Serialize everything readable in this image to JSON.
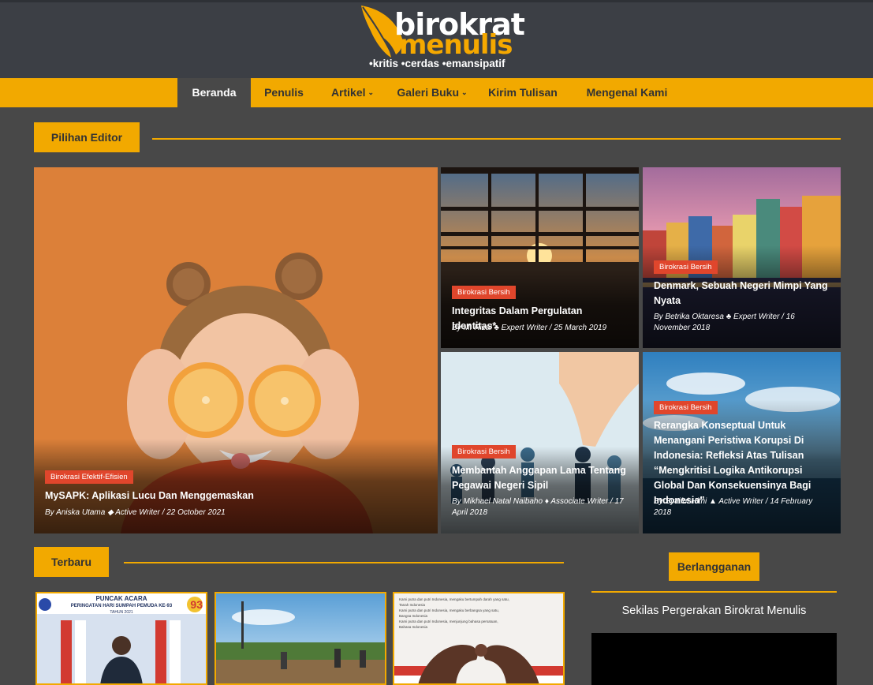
{
  "site": {
    "logo_word1": "birokrat",
    "logo_word2": "menulis",
    "tagline": "•kritis •cerdas •emansipatif"
  },
  "nav": {
    "items": [
      {
        "label": "Beranda"
      },
      {
        "label": "Penulis"
      },
      {
        "label": "Artikel",
        "chevron": "⌄"
      },
      {
        "label": "Galeri Buku",
        "chevron": "⌄"
      },
      {
        "label": "Kirim Tulisan"
      },
      {
        "label": "Mengenal Kami"
      }
    ]
  },
  "sections": {
    "editor_pick": "Pilihan Editor",
    "latest": "Terbaru",
    "subscribe": "Berlangganan"
  },
  "featured": [
    {
      "category": "Birokrasi Efektif-Efisien",
      "title": "MySAPK: Aplikasi Lucu Dan Menggemaskan",
      "meta": "By Aniska Utama ◆ Active Writer  /  22 October 2021"
    },
    {
      "category": "Birokrasi Bersih",
      "title": "Integritas Dalam Pergulatan Identitas*",
      "meta": "By M. Rizal ♣ Expert Writer  /  25 March 2019"
    },
    {
      "category": "Birokrasi Bersih",
      "title": "Denmark, Sebuah Negeri Mimpi Yang Nyata",
      "meta": "By Betrika Oktaresa ♣ Expert Writer  /  16 November 2018"
    },
    {
      "category": "Birokrasi Bersih",
      "title": "Membantah Anggapan Lama Tentang Pegawai Negeri Sipil",
      "meta": "By Mikhael Natal Naibaho ♦ Associate Writer  /  17 April 2018"
    },
    {
      "category": "Birokrasi Bersih",
      "title": "Rerangka Konseptual Untuk Menangani Peristiwa Korupsi Di Indonesia: Refleksi Atas Tulisan “Mengkritisi Logika Antikorupsi Global Dan Konsekuensinya Bagi Indonesia”",
      "meta": "By Syaiful Hifni ▲ Active Writer  /  14 February 2018"
    }
  ],
  "latest_thumbs": [
    {
      "line1": "PUNCAK ACARA",
      "line2": "PERINGATAN HARI SUMPAH PEMUDA KE-93",
      "line3": "TAHUN 2021",
      "badge": "93"
    },
    {},
    {
      "poem_lines": [
        "Kami putra dan putri Indonesia, mengaku bertumpah darah yang satu,",
        "Tanah Indonesia",
        "Kami putra dan putri Indonesia, mengaku berbangsa yang satu,",
        "Bangsa Indonesia",
        "Kami putra dan putri Indonesia, menjunjung bahasa persatuan,",
        "Bahasa Indonesia"
      ]
    }
  ],
  "sidebar": {
    "video_title": "Sekilas Pergerakan Birokrat Menulis"
  },
  "colors": {
    "accent": "#f2a900",
    "badge": "#e0462c",
    "header_bg": "#3c3f45",
    "page_bg": "#484848"
  }
}
